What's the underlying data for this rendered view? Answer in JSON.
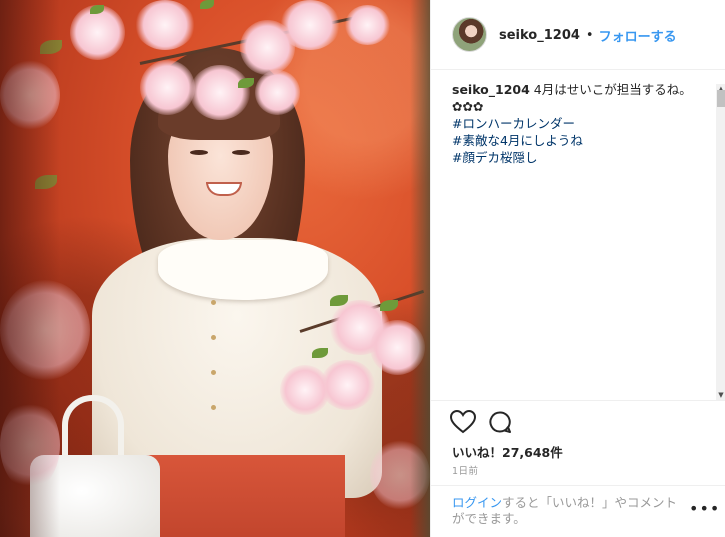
{
  "header": {
    "username": "seiko_1204",
    "separator": "•",
    "follow_label": "フォローする"
  },
  "caption": {
    "author": "seiko_1204",
    "text": " 4月はせいこが担当するね。✿✿✿",
    "hashtags": [
      "#ロンハーカレンダー",
      "#素敵な4月にしようね",
      "#顔デカ桜隠し"
    ]
  },
  "actions": {
    "like_icon": "heart-icon",
    "comment_icon": "comment-icon",
    "likes_text": "いいね！27,648件",
    "time_text": "1日前"
  },
  "login_prompt": {
    "link_text": "ログイン",
    "rest_text": "すると「いいね！」やコメントができます。",
    "more_label": "•••"
  },
  "scrollbar": {
    "up": "▲",
    "down": "▼"
  },
  "colors": {
    "link_blue": "#3897f0",
    "hashtag": "#003569",
    "muted": "#999999",
    "text": "#262626"
  }
}
